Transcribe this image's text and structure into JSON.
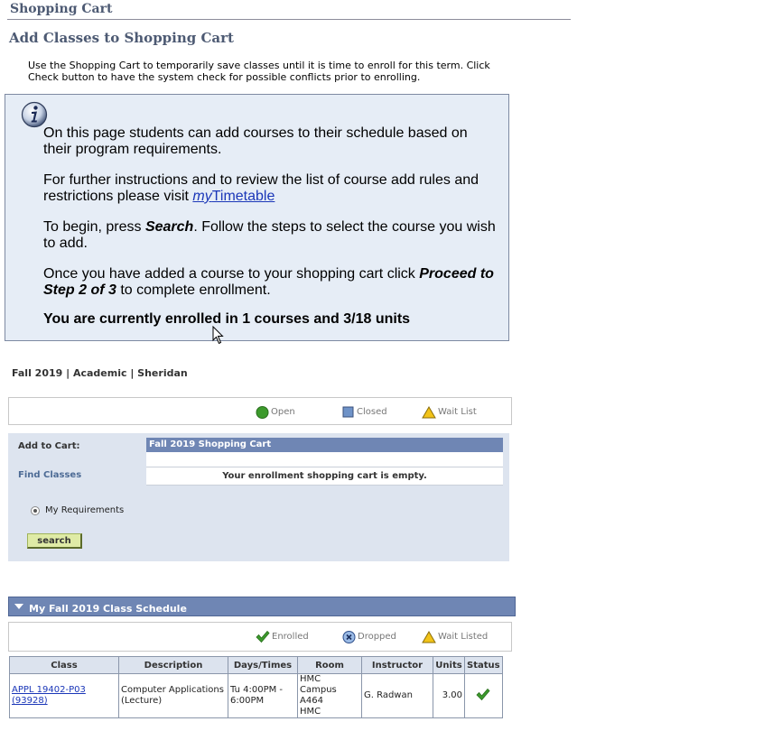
{
  "header": {
    "title": "Shopping Cart",
    "subtitle": "Add Classes to Shopping Cart",
    "intro": "Use the Shopping Cart to temporarily save classes until it is time to enroll for this term.  Click Check button to have the system check for possible conflicts prior to enrolling."
  },
  "info": {
    "p1": "On this page students can add courses to their schedule based on their program requirements.",
    "p2_prefix": "For further instructions and to review the list of course add rules and restrictions please visit ",
    "p2_link_italic": "my",
    "p2_link_rest": "Timetable",
    "p3_prefix": "To begin, press ",
    "p3_bold": "Search",
    "p3_suffix": ". Follow the steps to select the course you wish to add.",
    "p4_prefix": "Once you have added a course to your shopping cart click ",
    "p4_bold": "Proceed to Step 2 of 3",
    "p4_suffix": " to complete enrollment.",
    "p5": "You are currently enrolled in 1 courses and 3/18 units"
  },
  "term": "Fall 2019 | Academic | Sheridan",
  "legend1": {
    "open": "Open",
    "closed": "Closed",
    "wait": "Wait List"
  },
  "cart": {
    "add_to_cart": "Add to Cart:",
    "find_classes": "Find Classes",
    "header": "Fall 2019 Shopping Cart",
    "empty": "Your enrollment shopping cart is empty.",
    "radio_label": "My Requirements",
    "search_label": "search"
  },
  "schedule": {
    "title": "My Fall 2019 Class Schedule",
    "legend": {
      "enrolled": "Enrolled",
      "dropped": "Dropped",
      "wait": "Wait Listed"
    },
    "columns": [
      "Class",
      "Description",
      "Days/Times",
      "Room",
      "Instructor",
      "Units",
      "Status"
    ],
    "row": {
      "class_line1": "APPL 19402-P03",
      "class_line2": "(93928)",
      "description_line1": "Computer Applications",
      "description_line2": "(Lecture)",
      "times_line1": "Tu 4:00PM -",
      "times_line2": "6:00PM",
      "room_line1": "HMC Campus",
      "room_line2": "A464",
      "room_line3": "HMC",
      "instructor": "G. Radwan",
      "units": "3.00"
    }
  },
  "colors": {
    "header_text": "#4d5a73",
    "info_bg": "#e6edf6",
    "panel_header": "#6f86b4",
    "link": "#1a36b8",
    "open_green": "#3c9a2c",
    "closed_blue": "#6f93c8",
    "wait_yellow": "#f2c318"
  },
  "icons": {
    "info": "info-circle-icon",
    "open": "green-circle-icon",
    "closed": "blue-square-icon",
    "wait": "yellow-triangle-icon",
    "enrolled": "green-check-icon",
    "dropped": "blue-x-circle-icon",
    "collapse": "triangle-down-icon"
  }
}
